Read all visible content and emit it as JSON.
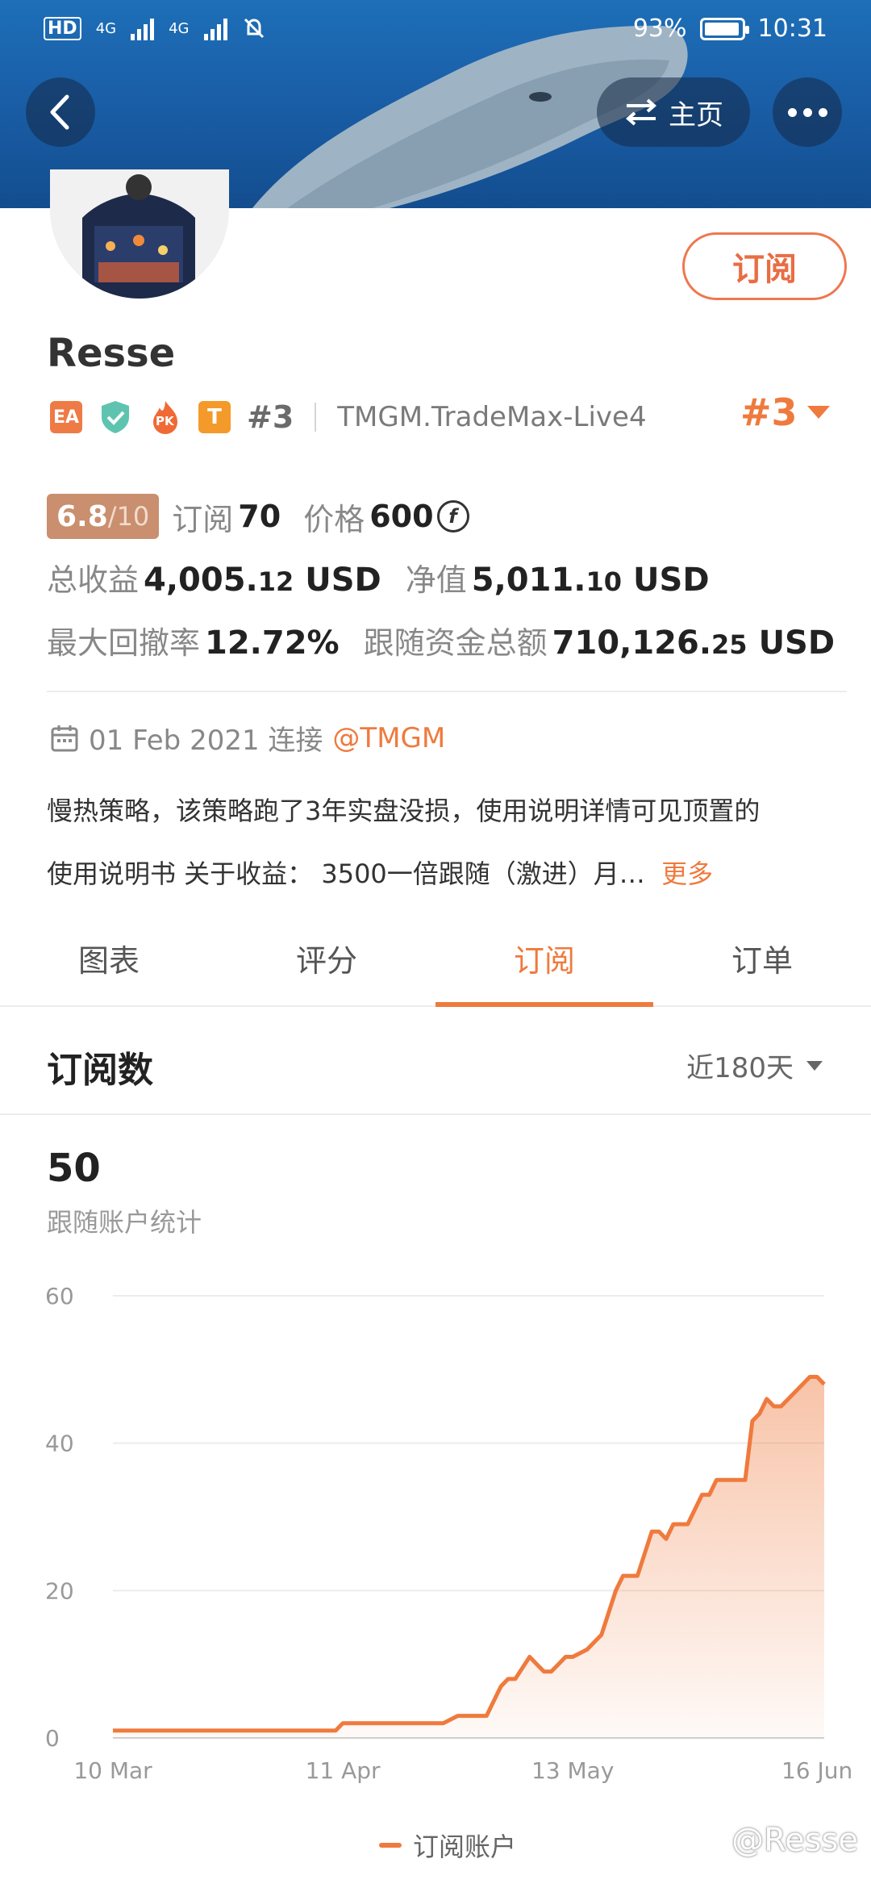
{
  "status_bar": {
    "left_label_1": "HD",
    "net_1": "4G",
    "net_2": "4G",
    "battery": "93%",
    "time": "10:31"
  },
  "header": {
    "home_label": "主页"
  },
  "profile": {
    "name": "Resse",
    "subscribe_label": "订阅",
    "badges": {
      "ea": "EA",
      "pk": "PK",
      "t": "T"
    },
    "rank_small": "#3",
    "server": "TMGM.TradeMax-Live4",
    "rank_big": "#3"
  },
  "stats": {
    "score_main": "6.8",
    "score_den": "/10",
    "subscribe_label": "订阅",
    "subscribe_count": "70",
    "price_label": "价格",
    "price_value": "600",
    "coin_symbol": "f",
    "total_profit_label": "总收益",
    "total_profit_int": "4,005.",
    "total_profit_dec": "12",
    "total_profit_unit": "USD",
    "equity_label": "净值",
    "equity_int": "5,011.",
    "equity_dec": "10",
    "equity_unit": "USD",
    "drawdown_label": "最大回撤率",
    "drawdown_value": "12.72%",
    "follow_funds_label": "跟随资金总额",
    "follow_funds_int": "710,126.",
    "follow_funds_dec": "25",
    "follow_funds_unit": "USD"
  },
  "info": {
    "date": "01 Feb 2021 连接",
    "broker": "@TMGM",
    "description_line1": "慢热策略，该策略跑了3年实盘没损，使用说明详情可见顶置的",
    "description_line2": "使用说明书 关于收益： 3500一倍跟随（激进）月…",
    "more_label": "更多"
  },
  "tabs": [
    {
      "label": "图表"
    },
    {
      "label": "评分"
    },
    {
      "label": "订阅"
    },
    {
      "label": "订单"
    }
  ],
  "section": {
    "title": "订阅数",
    "range_label": "近180天",
    "big_number": "50",
    "sub_label": "跟随账户统计"
  },
  "chart_data": {
    "type": "area",
    "x_tick_labels": [
      "10 Mar",
      "11 Apr",
      "13 May",
      "16 Jun"
    ],
    "y_ticks": [
      0,
      20,
      40,
      60
    ],
    "ylim": [
      0,
      60
    ],
    "series": [
      {
        "name": "订阅账户",
        "color": "#ef7a3d",
        "x": [
          "03-10",
          "03-25",
          "04-10",
          "04-11",
          "04-25",
          "04-27",
          "05-01",
          "05-02",
          "05-03",
          "05-04",
          "05-05",
          "05-07",
          "05-08",
          "05-09",
          "05-10",
          "05-11",
          "05-12",
          "05-13",
          "05-15",
          "05-17",
          "05-18",
          "05-19",
          "05-20",
          "05-21",
          "05-22",
          "05-24",
          "05-25",
          "05-26",
          "05-27",
          "05-28",
          "05-29",
          "05-30",
          "05-31",
          "06-01",
          "06-02",
          "06-04",
          "06-06",
          "06-07",
          "06-08",
          "06-09",
          "06-10",
          "06-11",
          "06-13",
          "06-14",
          "06-15",
          "06-16",
          "06-17"
        ],
        "values": [
          1,
          1,
          1,
          2,
          2,
          3,
          3,
          5,
          7,
          8,
          8,
          11,
          10,
          9,
          9,
          10,
          11,
          11,
          12,
          14,
          17,
          20,
          22,
          22,
          22,
          28,
          28,
          27,
          29,
          29,
          29,
          31,
          33,
          33,
          35,
          35,
          35,
          43,
          44,
          46,
          45,
          45,
          47,
          48,
          49,
          49,
          48
        ]
      }
    ],
    "legend": [
      "订阅账户"
    ],
    "grid": true,
    "legend_position": "bottom-center"
  },
  "watermark": "@Resse"
}
